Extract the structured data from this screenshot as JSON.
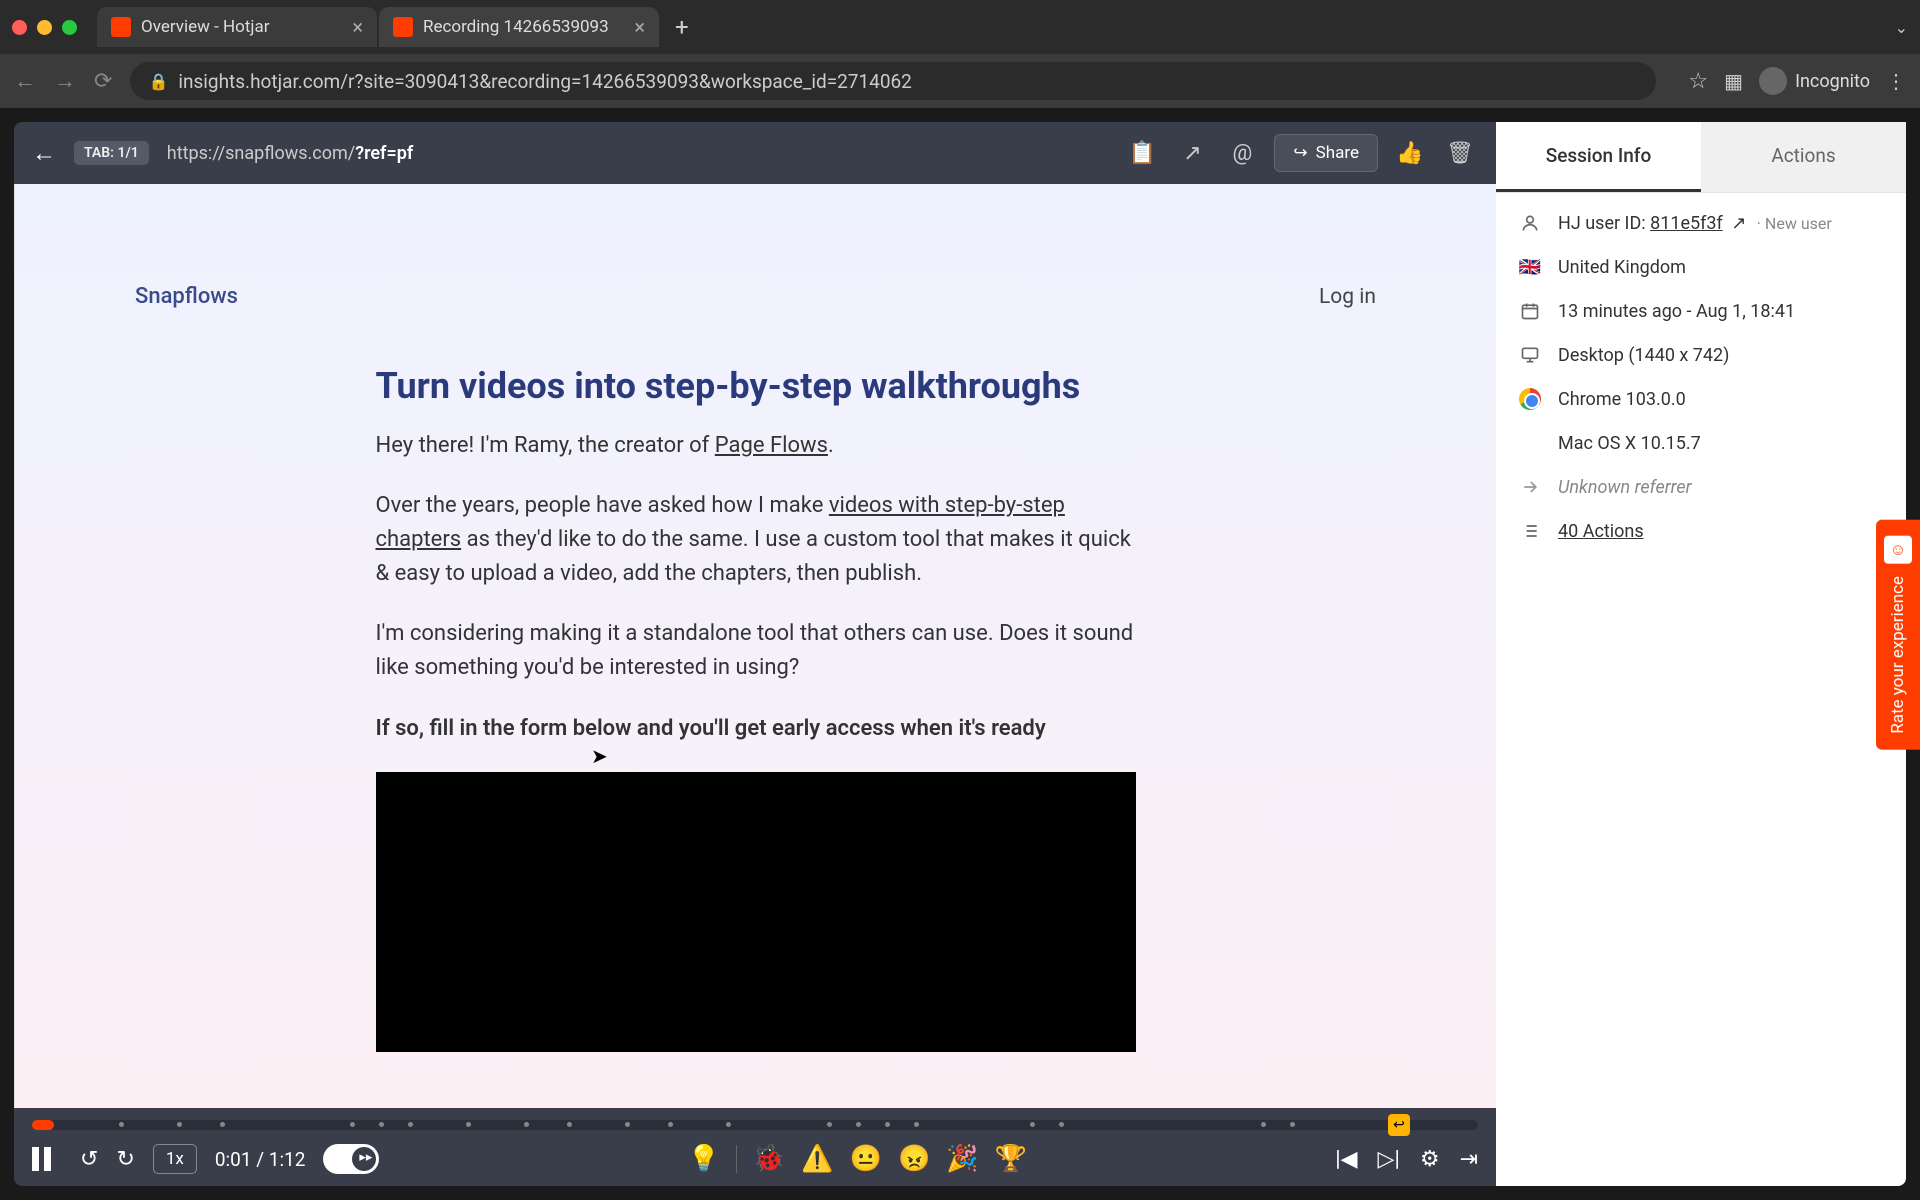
{
  "browser": {
    "tabs": [
      {
        "title": "Overview - Hotjar",
        "active": false
      },
      {
        "title": "Recording 14266539093",
        "active": true
      }
    ],
    "url": "insights.hotjar.com/r?site=3090413&recording=14266539093&workspace_id=2714062",
    "incognito_label": "Incognito"
  },
  "toolbar": {
    "tab_badge": "TAB: 1/1",
    "url_prefix": "https://snapflows.com/",
    "url_bold": "?ref=pf",
    "share_label": "Share"
  },
  "page": {
    "brand": "Snapflows",
    "login": "Log in",
    "title": "Turn videos into step-by-step walkthroughs",
    "p1_a": "Hey there! I'm Ramy, the creator of ",
    "p1_link": "Page Flows",
    "p1_b": ".",
    "p2_a": "Over the years, people have asked how I make ",
    "p2_link": "videos with step-by-step chapters",
    "p2_b": " as they'd like to do the same. I use a custom tool that makes it quick & easy to upload a video, add the chapters, then publish.",
    "p3": "I'm considering making it a standalone tool that others can use. Does it sound like something you'd be interested in using?",
    "p4": "If so, fill in the form below and you'll get early access when it's ready"
  },
  "playback": {
    "speed": "1x",
    "time": "0:01 / 1:12",
    "emojis": [
      "💡",
      "🐞",
      "⚠️",
      "😐",
      "😠",
      "🎉",
      "🏆"
    ]
  },
  "sidebar": {
    "tab_session": "Session Info",
    "tab_actions": "Actions",
    "user_label": "HJ user ID: ",
    "user_id": "811e5f3f",
    "new_user": "· New user",
    "country": "United Kingdom",
    "time": "13 minutes ago - Aug 1, 18:41",
    "device": "Desktop (1440 x 742)",
    "browser_info": "Chrome 103.0.0",
    "os": "Mac OS X 10.15.7",
    "referrer": "Unknown referrer",
    "actions_count": "40 Actions"
  },
  "feedback": {
    "label": "Rate your experience"
  }
}
